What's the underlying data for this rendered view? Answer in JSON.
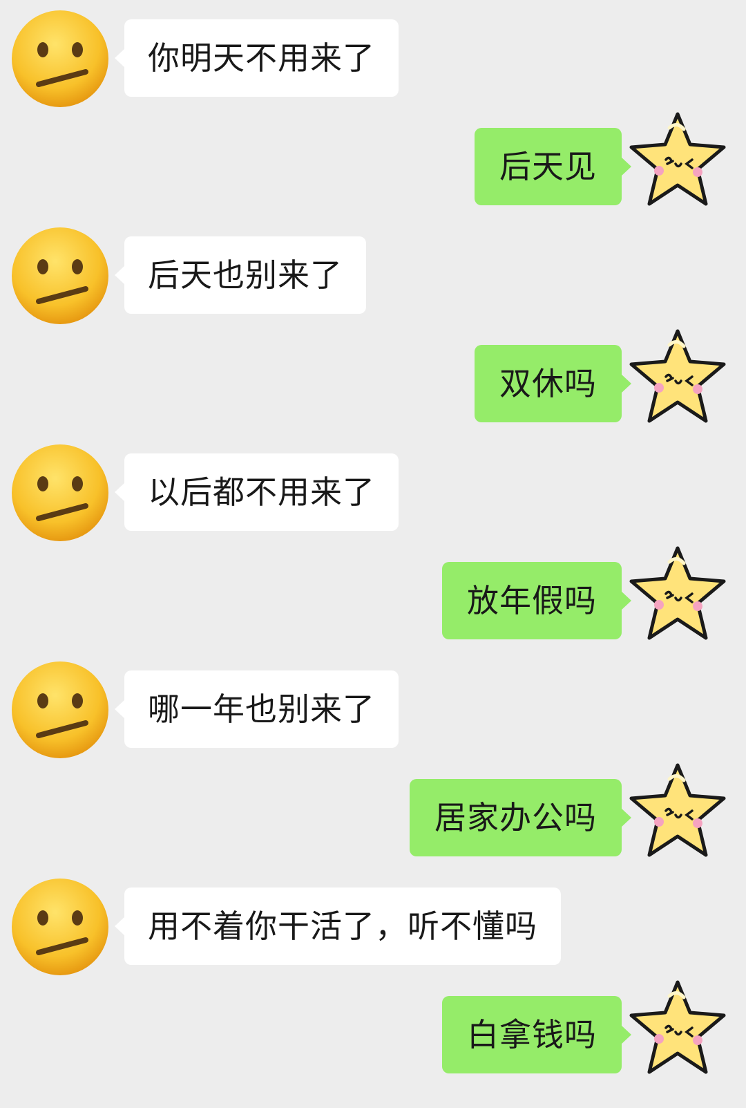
{
  "colors": {
    "background": "#ededed",
    "incoming_bubble": "#ffffff",
    "outgoing_bubble": "#95ec69",
    "text": "#191919"
  },
  "avatars": {
    "incoming": "neutral-face-emoji-icon",
    "outgoing": "cute-star-icon"
  },
  "messages": [
    {
      "side": "left",
      "text": "你明天不用来了"
    },
    {
      "side": "right",
      "text": "后天见"
    },
    {
      "side": "left",
      "text": "后天也别来了"
    },
    {
      "side": "right",
      "text": "双休吗"
    },
    {
      "side": "left",
      "text": "以后都不用来了"
    },
    {
      "side": "right",
      "text": "放年假吗"
    },
    {
      "side": "left",
      "text": "哪一年也别来了"
    },
    {
      "side": "right",
      "text": "居家办公吗"
    },
    {
      "side": "left",
      "text": "用不着你干活了，听不懂吗"
    },
    {
      "side": "right",
      "text": "白拿钱吗"
    }
  ]
}
